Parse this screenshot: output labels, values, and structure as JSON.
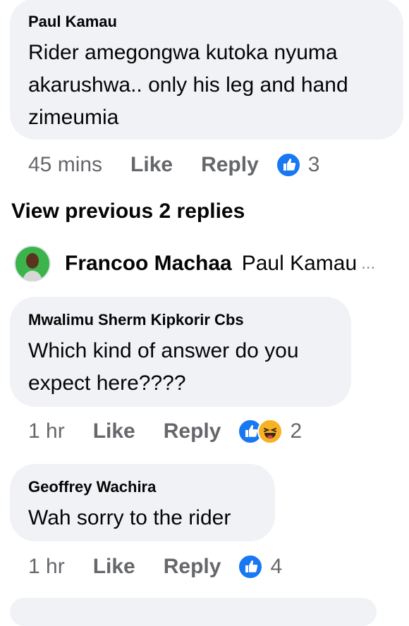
{
  "comments": [
    {
      "author": "Paul Kamau",
      "lines": [
        "Rider amegongwa kutoka nyuma",
        "akarushwa.. only his leg and hand",
        "zimeumia"
      ],
      "time": "45 mins",
      "like_label": "Like",
      "reply_label": "Reply",
      "reaction_count": "3",
      "reactions": [
        "like-icon"
      ]
    },
    {
      "author": "Mwalimu Sherm Kipkorir Cbs",
      "lines": [
        "Which kind of answer do you",
        "expect here????"
      ],
      "time": "1 hr",
      "like_label": "Like",
      "reply_label": "Reply",
      "reaction_count": "2",
      "reactions": [
        "like-icon",
        "haha-icon"
      ]
    },
    {
      "author": "Geoffrey Wachira",
      "lines": [
        "Wah sorry to the rider"
      ],
      "time": "1 hr",
      "like_label": "Like",
      "reply_label": "Reply",
      "reaction_count": "4",
      "reactions": [
        "like-icon"
      ]
    }
  ],
  "view_previous": "View previous 2 replies",
  "reply_preview": {
    "name": "Francoo Machaa",
    "text": "Paul Kamau",
    "ellipsis": "..."
  },
  "colors": {
    "bubble": "#f0f2f5",
    "meta_text": "#65676b",
    "like_blue": "#1877f2",
    "haha_yellow": "#f7b125"
  }
}
